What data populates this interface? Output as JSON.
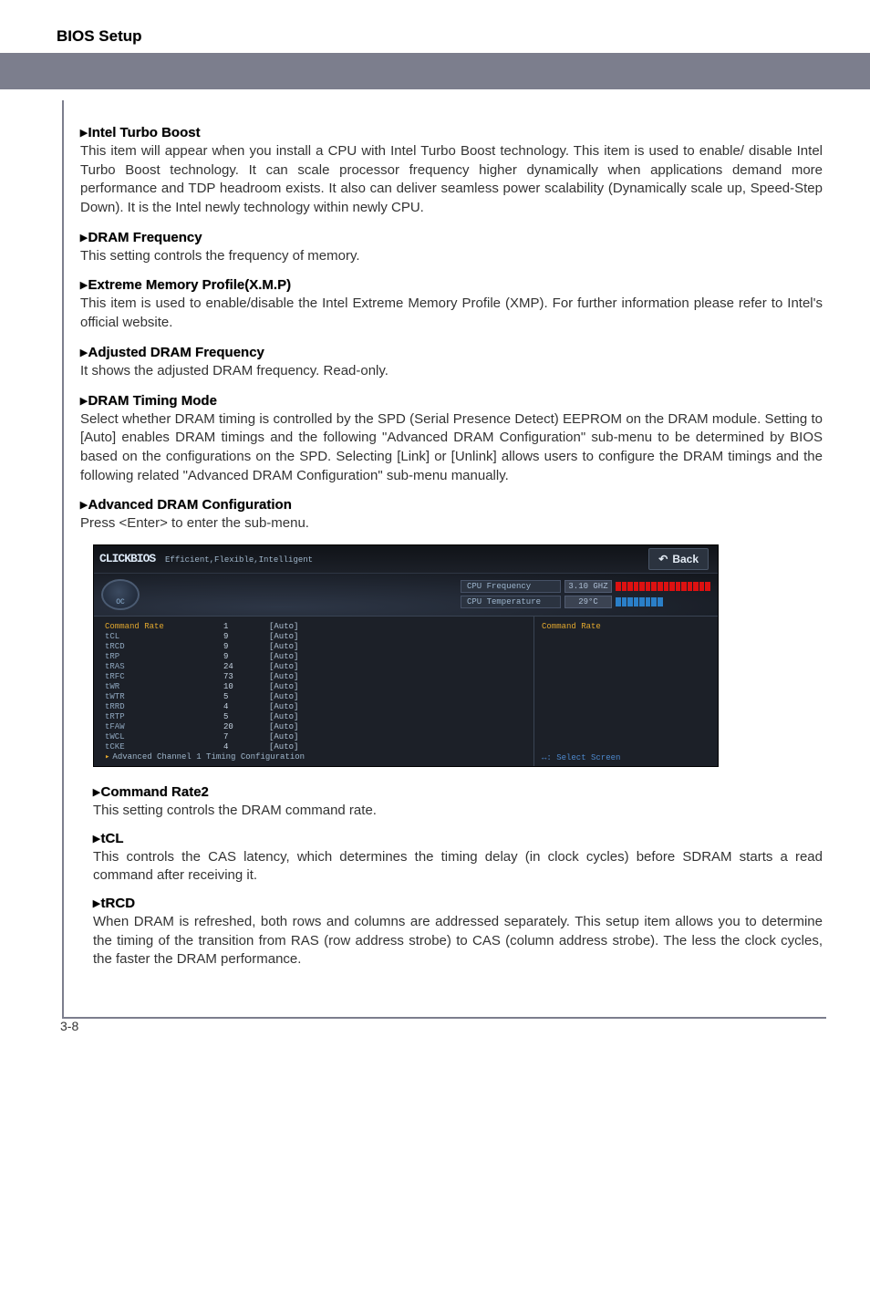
{
  "page": {
    "header": "BIOS Setup",
    "footer": "3-8",
    "arrow": "▸"
  },
  "sections": [
    {
      "title": "Intel Turbo Boost",
      "body": "This item will appear when you install a CPU with Intel Turbo Boost technology. This item is used to enable/ disable Intel Turbo Boost technology. It can scale processor frequency higher dynamically when applications demand more performance and TDP headroom exists. It also can deliver seamless power scalability (Dynamically scale up, Speed-Step Down). It is the Intel newly technology within newly CPU."
    },
    {
      "title": "DRAM Frequency",
      "body": "This setting controls the frequency of memory."
    },
    {
      "title": "Extreme Memory Profile(X.M.P)",
      "body": "This item is used to enable/disable the Intel Extreme Memory Profile (XMP). For further information please refer to Intel's official website."
    },
    {
      "title": "Adjusted DRAM Frequency",
      "body": "It shows the adjusted DRAM frequency. Read-only."
    },
    {
      "title": "DRAM Timing Mode",
      "body": "Select whether DRAM timing is controlled by the SPD (Serial Presence Detect) EEPROM on the DRAM module. Setting to [Auto] enables DRAM timings and the following \"Advanced DRAM Configuration\" sub-menu to be determined by BIOS based on the configurations on the SPD. Selecting [Link] or [Unlink] allows users to configure the DRAM timings and the following related \"Advanced DRAM Configuration\" sub-menu manually."
    },
    {
      "title": "Advanced DRAM Configuration",
      "body": "Press <Enter> to enter the sub-menu."
    }
  ],
  "subsections": [
    {
      "title": "Command Rate2",
      "body": "This setting controls the DRAM command rate."
    },
    {
      "title": "tCL",
      "body": "This controls the CAS latency, which determines the timing delay (in clock cycles) before SDRAM starts a read command after receiving it."
    },
    {
      "title": "tRCD",
      "body": "When DRAM is refreshed, both rows and columns are addressed separately. This setup item allows you to determine the timing of the transition from RAS (row address strobe) to CAS (column address strobe). The less the clock cycles, the faster the DRAM performance."
    }
  ],
  "bios": {
    "logo": "CLICKBIOS",
    "logo_sub": "Efficient,Flexible,Intelligent",
    "back": "Back",
    "oc_label": "OC",
    "stats": {
      "freq_label": "CPU Frequency",
      "freq_value": "3.10 GHZ",
      "temp_label": "CPU Temperature",
      "temp_value": "29°C"
    },
    "side_title": "Command Rate",
    "side_hint": "↔: Select Screen",
    "rows": [
      {
        "name": "Command Rate",
        "val": "1",
        "opt": "[Auto]",
        "hl": true
      },
      {
        "name": "tCL",
        "val": "9",
        "opt": "[Auto]"
      },
      {
        "name": "tRCD",
        "val": "9",
        "opt": "[Auto]"
      },
      {
        "name": "tRP",
        "val": "9",
        "opt": "[Auto]"
      },
      {
        "name": "tRAS",
        "val": "24",
        "opt": "[Auto]"
      },
      {
        "name": "tRFC",
        "val": "73",
        "opt": "[Auto]"
      },
      {
        "name": "tWR",
        "val": "10",
        "opt": "[Auto]"
      },
      {
        "name": "tWTR",
        "val": "5",
        "opt": "[Auto]"
      },
      {
        "name": "tRRD",
        "val": "4",
        "opt": "[Auto]"
      },
      {
        "name": "tRTP",
        "val": "5",
        "opt": "[Auto]"
      },
      {
        "name": "tFAW",
        "val": "20",
        "opt": "[Auto]"
      },
      {
        "name": "tWCL",
        "val": "7",
        "opt": "[Auto]"
      },
      {
        "name": "tCKE",
        "val": "4",
        "opt": "[Auto]"
      }
    ],
    "adv_row": "Advanced Channel 1 Timing Configuration"
  }
}
